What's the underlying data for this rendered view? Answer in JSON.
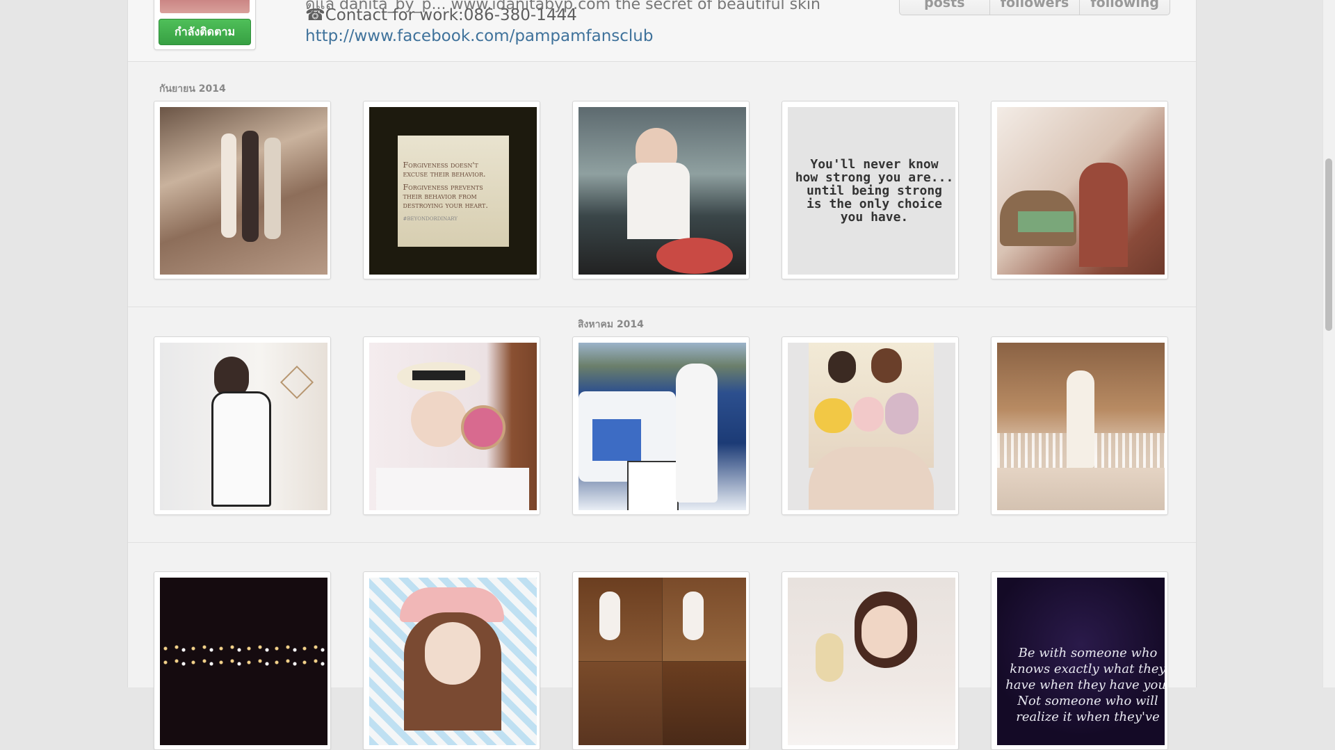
{
  "header": {
    "follow_button": "กำลังติดตาม",
    "bio_cut": "ดูแล danita_by_p...  www.idanitabyp.com  the secret of beautiful skin",
    "contact": "☎Contact for work:086-380-1444",
    "link": "http://www.facebook.com/pampamfansclub",
    "stats": [
      "posts",
      "followers",
      "following"
    ]
  },
  "months": [
    "กันยายน 2014",
    "สิงหาคม 2014"
  ],
  "quotes": {
    "forgiveness_1": "Forgiveness doesn't excuse their behavior.",
    "forgiveness_2": "Forgiveness prevents their behavior from destroying your heart.",
    "forgiveness_tag": "#BEYONDORDINARY",
    "strong_1": "You'll never know",
    "strong_2": "how strong you are...",
    "strong_3": "until being strong",
    "strong_4": "is the only choice",
    "strong_5": "you have.",
    "be_with_1": "Be with someone who",
    "be_with_2": "knows exactly what they",
    "be_with_3": "have when they have you.",
    "be_with_4": "Not someone who will",
    "be_with_5": "realize it when they've"
  },
  "photo_icons": [
    "photo-three-friends",
    "photo-forgiveness-quote",
    "photo-peace-sign-dinner",
    "photo-strong-quote",
    "photo-holding-bottle",
    "photo-white-dress-mirror",
    "photo-hat-compact",
    "photo-race-car",
    "photo-plush-toys",
    "photo-glass-walkway",
    "photo-night-city",
    "photo-cap-illustration",
    "photo-collage-friends",
    "photo-bed-selfie",
    "photo-be-with-quote"
  ],
  "colors": {
    "follow_green": "#3ba946",
    "link_blue": "#3f729b"
  }
}
